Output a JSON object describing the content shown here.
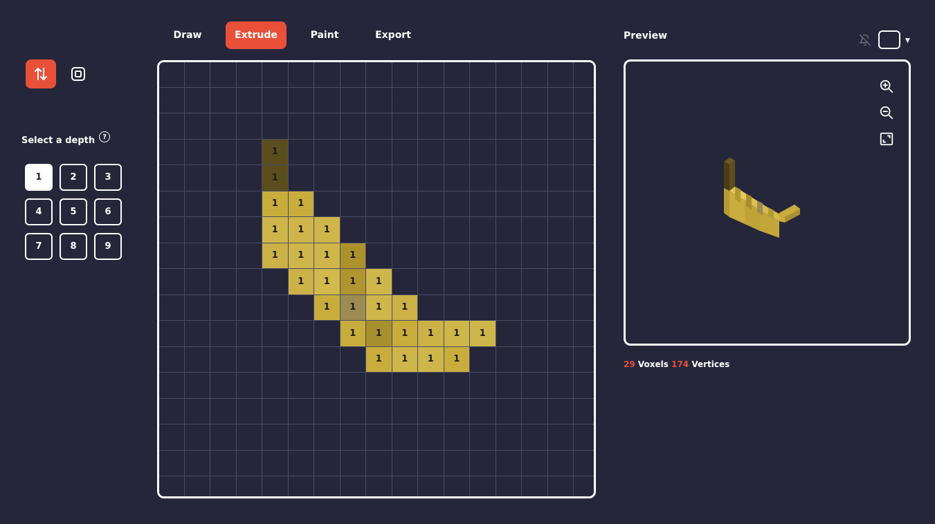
{
  "toolbar": {
    "extrude_mode_icon": "arrows-up-down-icon",
    "square_mode_icon": "square-frame-icon"
  },
  "depth": {
    "title": "Select a depth",
    "help_icon": "question-circle-icon",
    "help_glyph": "?",
    "options": [
      "1",
      "2",
      "3",
      "4",
      "5",
      "6",
      "7",
      "8",
      "9"
    ],
    "selected": "1"
  },
  "tabs": [
    {
      "label": "Draw",
      "active": false
    },
    {
      "label": "Extrude",
      "active": true
    },
    {
      "label": "Paint",
      "active": false
    },
    {
      "label": "Export",
      "active": false
    }
  ],
  "grid": {
    "size": 17,
    "empty_color": "#25263a",
    "cells": [
      {
        "row": 3,
        "col": 4,
        "color": "#5c4d1f",
        "label": "1"
      },
      {
        "row": 4,
        "col": 4,
        "color": "#5c4d1f",
        "label": "1"
      },
      {
        "row": 5,
        "col": 4,
        "color": "#c8ad3c",
        "label": "1"
      },
      {
        "row": 5,
        "col": 5,
        "color": "#c8ad3c",
        "label": "1"
      },
      {
        "row": 6,
        "col": 4,
        "color": "#cfb64a",
        "label": "1"
      },
      {
        "row": 6,
        "col": 5,
        "color": "#cfb64a",
        "label": "1"
      },
      {
        "row": 6,
        "col": 6,
        "color": "#cfb64a",
        "label": "1"
      },
      {
        "row": 7,
        "col": 4,
        "color": "#cbb146",
        "label": "1"
      },
      {
        "row": 7,
        "col": 5,
        "color": "#cfb64a",
        "label": "1"
      },
      {
        "row": 7,
        "col": 6,
        "color": "#cfb64a",
        "label": "1"
      },
      {
        "row": 7,
        "col": 7,
        "color": "#ad922c",
        "label": "1"
      },
      {
        "row": 8,
        "col": 5,
        "color": "#cbb146",
        "label": "1"
      },
      {
        "row": 8,
        "col": 6,
        "color": "#d2b94c",
        "label": "1"
      },
      {
        "row": 8,
        "col": 7,
        "color": "#b0952e",
        "label": "1"
      },
      {
        "row": 8,
        "col": 8,
        "color": "#cfb64a",
        "label": "1"
      },
      {
        "row": 9,
        "col": 6,
        "color": "#c8ad3c",
        "label": "1"
      },
      {
        "row": 9,
        "col": 7,
        "color": "#9c8c52",
        "label": "1"
      },
      {
        "row": 9,
        "col": 8,
        "color": "#cfb64a",
        "label": "1"
      },
      {
        "row": 9,
        "col": 9,
        "color": "#cbb146",
        "label": "1"
      },
      {
        "row": 10,
        "col": 7,
        "color": "#c8ad3c",
        "label": "1"
      },
      {
        "row": 10,
        "col": 8,
        "color": "#a8902e",
        "label": "1"
      },
      {
        "row": 10,
        "col": 9,
        "color": "#c8ad3c",
        "label": "1"
      },
      {
        "row": 10,
        "col": 10,
        "color": "#cbb146",
        "label": "1"
      },
      {
        "row": 10,
        "col": 11,
        "color": "#cfb64a",
        "label": "1"
      },
      {
        "row": 10,
        "col": 12,
        "color": "#cfb64a",
        "label": "1"
      },
      {
        "row": 11,
        "col": 8,
        "color": "#c8ad3c",
        "label": "1"
      },
      {
        "row": 11,
        "col": 9,
        "color": "#cfb64a",
        "label": "1"
      },
      {
        "row": 11,
        "col": 10,
        "color": "#cfb64a",
        "label": "1"
      },
      {
        "row": 11,
        "col": 11,
        "color": "#c8ad3c",
        "label": "1"
      }
    ]
  },
  "preview": {
    "title": "Preview",
    "notify_icon": "bell-off-icon",
    "swatch_color": "#25263a",
    "caret_glyph": "▼",
    "zoom_in_icon": "zoom-in-icon",
    "zoom_out_icon": "zoom-out-icon",
    "fit_icon": "fit-view-icon"
  },
  "stats": {
    "voxels": "29",
    "voxels_label": "Voxels",
    "vertices": "174",
    "vertices_label": "Vertices"
  },
  "colors": {
    "background": "#25263a",
    "accent": "#e8503a",
    "grid_line": "#4a4c64"
  }
}
